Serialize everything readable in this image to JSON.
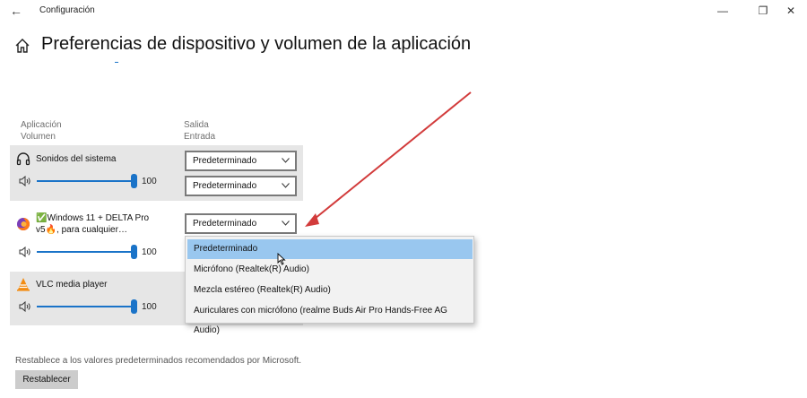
{
  "window": {
    "title": "Configuración",
    "back_glyph": "←",
    "minimize_glyph": "—",
    "restore_glyph": "❐",
    "close_glyph": "✕"
  },
  "page": {
    "title": "Preferencias de dispositivo y volumen de la aplicación",
    "home_icon": "home-icon"
  },
  "columns": {
    "app": "Aplicación",
    "volume": "Volumen",
    "output": "Salida",
    "input": "Entrada"
  },
  "apps": [
    {
      "name": "Sonidos del sistema",
      "icon": "headphones-icon",
      "volume": "100",
      "output": "Predeterminado",
      "input": "Predeterminado"
    },
    {
      "name_line1": "✅Windows 11 + DELTA Pro",
      "name_line2": "v5🔥, para cualquier…",
      "icon": "firefox-icon",
      "volume": "100",
      "output": "Predeterminado"
    },
    {
      "name": "VLC media player",
      "icon": "vlc-icon",
      "volume": "100"
    }
  ],
  "dropdown": {
    "options": [
      "Predeterminado",
      "Micrófono (Realtek(R) Audio)",
      "Mezcla estéreo (Realtek(R) Audio)",
      "Auriculares con micrófono (realme Buds Air Pro Hands-Free AG Audio)"
    ],
    "selected": "Predeterminado"
  },
  "footer": {
    "description": "Restablece a los valores predeterminados recomendados por Microsoft.",
    "reset_label": "Restablecer"
  },
  "colors": {
    "accent": "#1a73c8",
    "highlight": "#99c7ef",
    "annotation_arrow": "#d23b3b",
    "row_bg": "#e6e6e6"
  }
}
